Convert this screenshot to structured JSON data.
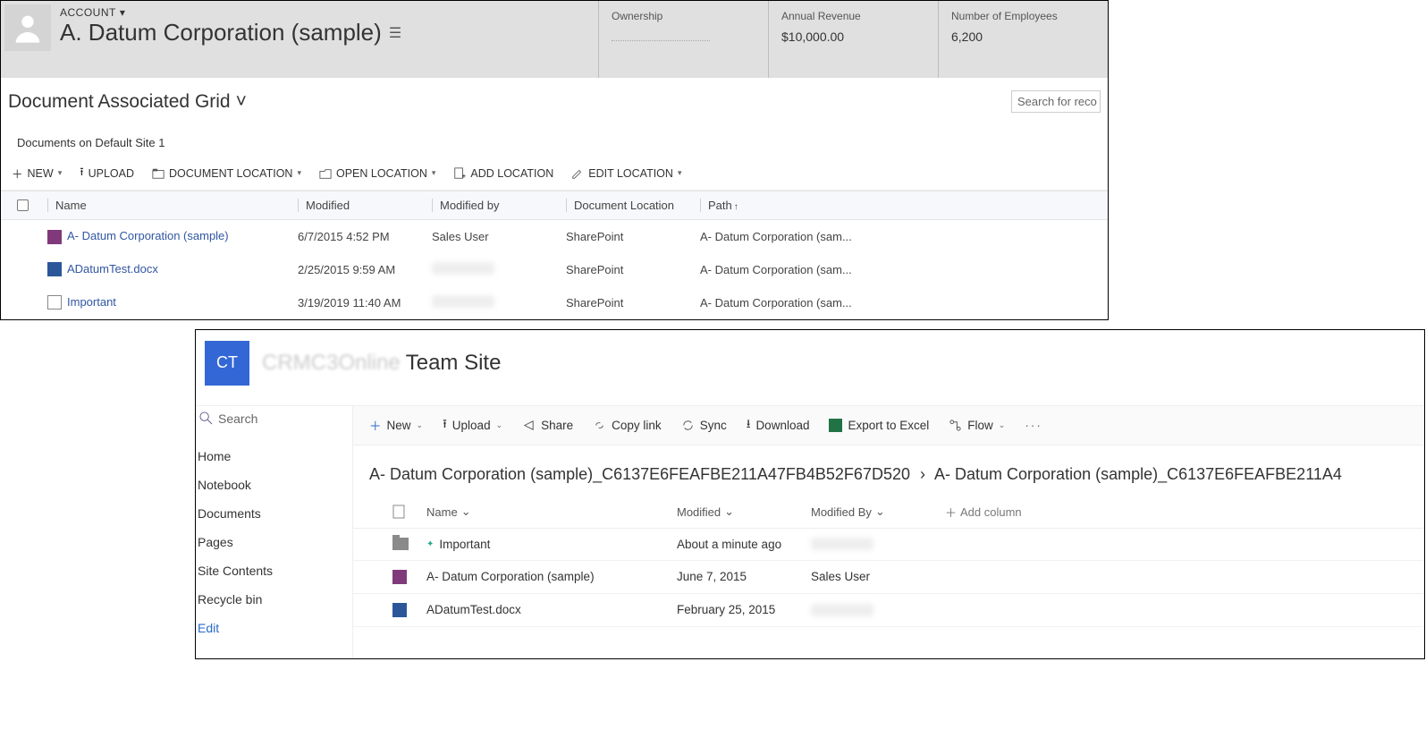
{
  "crm": {
    "entity_label": "ACCOUNT",
    "record_name": "A. Datum Corporation (sample)",
    "kpis": [
      {
        "label": "Ownership",
        "value": ""
      },
      {
        "label": "Annual Revenue",
        "value": "$10,000.00"
      },
      {
        "label": "Number of Employees",
        "value": "6,200"
      }
    ],
    "subgrid_title": "Document Associated Grid",
    "search_placeholder": "Search for reco",
    "location_label": "Documents on Default Site 1",
    "toolbar": {
      "new": "NEW",
      "upload": "UPLOAD",
      "doc_location": "DOCUMENT LOCATION",
      "open_location": "OPEN LOCATION",
      "add_location": "ADD LOCATION",
      "edit_location": "EDIT LOCATION"
    },
    "columns": {
      "name": "Name",
      "modified": "Modified",
      "modified_by": "Modified by",
      "doc_location": "Document Location",
      "path": "Path"
    },
    "rows": [
      {
        "icon": "onenote",
        "name": "A- Datum Corporation (sample)",
        "modified": "6/7/2015 4:52 PM",
        "modified_by": "Sales User",
        "location": "SharePoint",
        "path": "A- Datum Corporation (sam..."
      },
      {
        "icon": "word",
        "name": "ADatumTest.docx",
        "modified": "2/25/2015 9:59 AM",
        "modified_by": "",
        "location": "SharePoint",
        "path": "A- Datum Corporation (sam..."
      },
      {
        "icon": "page",
        "name": "Important",
        "modified": "3/19/2019 11:40 AM",
        "modified_by": "",
        "location": "SharePoint",
        "path": "A- Datum Corporation (sam..."
      }
    ]
  },
  "sp": {
    "logo_text": "CT",
    "site_name_ghost": "CRMC3Online",
    "site_name": "Team Site",
    "search_label": "Search",
    "nav": [
      "Home",
      "Notebook",
      "Documents",
      "Pages",
      "Site Contents",
      "Recycle bin"
    ],
    "edit_label": "Edit",
    "toolbar": {
      "new": "New",
      "upload": "Upload",
      "share": "Share",
      "copylink": "Copy link",
      "sync": "Sync",
      "download": "Download",
      "export": "Export to Excel",
      "flow": "Flow"
    },
    "breadcrumb": {
      "part1": "A- Datum Corporation (sample)_C6137E6FEAFBE211A47FB4B52F67D520",
      "part2": "A- Datum Corporation (sample)_C6137E6FEAFBE211A4"
    },
    "columns": {
      "name": "Name",
      "modified": "Modified",
      "modified_by": "Modified By",
      "add": "Add column"
    },
    "rows": [
      {
        "icon": "folder",
        "name": "Important",
        "modified": "About a minute ago",
        "modified_by": "",
        "is_new": true
      },
      {
        "icon": "onenote",
        "name": "A- Datum Corporation (sample)",
        "modified": "June 7, 2015",
        "modified_by": "Sales User"
      },
      {
        "icon": "word",
        "name": "ADatumTest.docx",
        "modified": "February 25, 2015",
        "modified_by": ""
      }
    ]
  }
}
